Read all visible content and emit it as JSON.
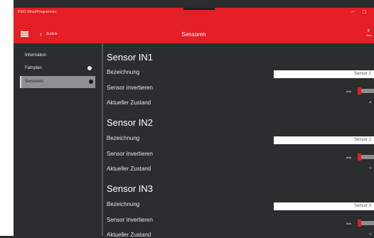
{
  "window": {
    "title": "PIKO SmartProgrammer",
    "minimize_glyph": "–",
    "maximize_glyph": "☐"
  },
  "header": {
    "back_glyph": "‹",
    "back_label": "Zurück",
    "page_title": "Sensoren",
    "right_icon_glyph": "◐",
    "right_caption": "Spei"
  },
  "sidebar": {
    "items": [
      {
        "label": "Information"
      },
      {
        "label": "Fahrplan"
      },
      {
        "label": "Sensoren"
      }
    ]
  },
  "sensors": [
    {
      "title": "Sensor IN1",
      "name_label": "Bezeichnung",
      "name_value": "Sensor 1",
      "invert_label": "Sensor invertieren",
      "toggle_label": "Aus",
      "state_label": "Aktueller Zustand",
      "state_value": "◒"
    },
    {
      "title": "Sensor IN2",
      "name_label": "Bezeichnung",
      "name_value": "Sensor 2",
      "invert_label": "Sensor invertieren",
      "toggle_label": "Aus",
      "state_label": "Aktueller Zustand",
      "state_value": "○"
    },
    {
      "title": "Sensor IN3",
      "name_label": "Bezeichnung",
      "name_value": "Sensor 3",
      "invert_label": "Sensor invertieren",
      "toggle_label": "Aus",
      "state_label": "Aktueller Zustand",
      "state_value": "○"
    }
  ],
  "colors": {
    "accent": "#e31e25",
    "background": "#2b2d2f",
    "sidebar_active": "#8f9091"
  }
}
